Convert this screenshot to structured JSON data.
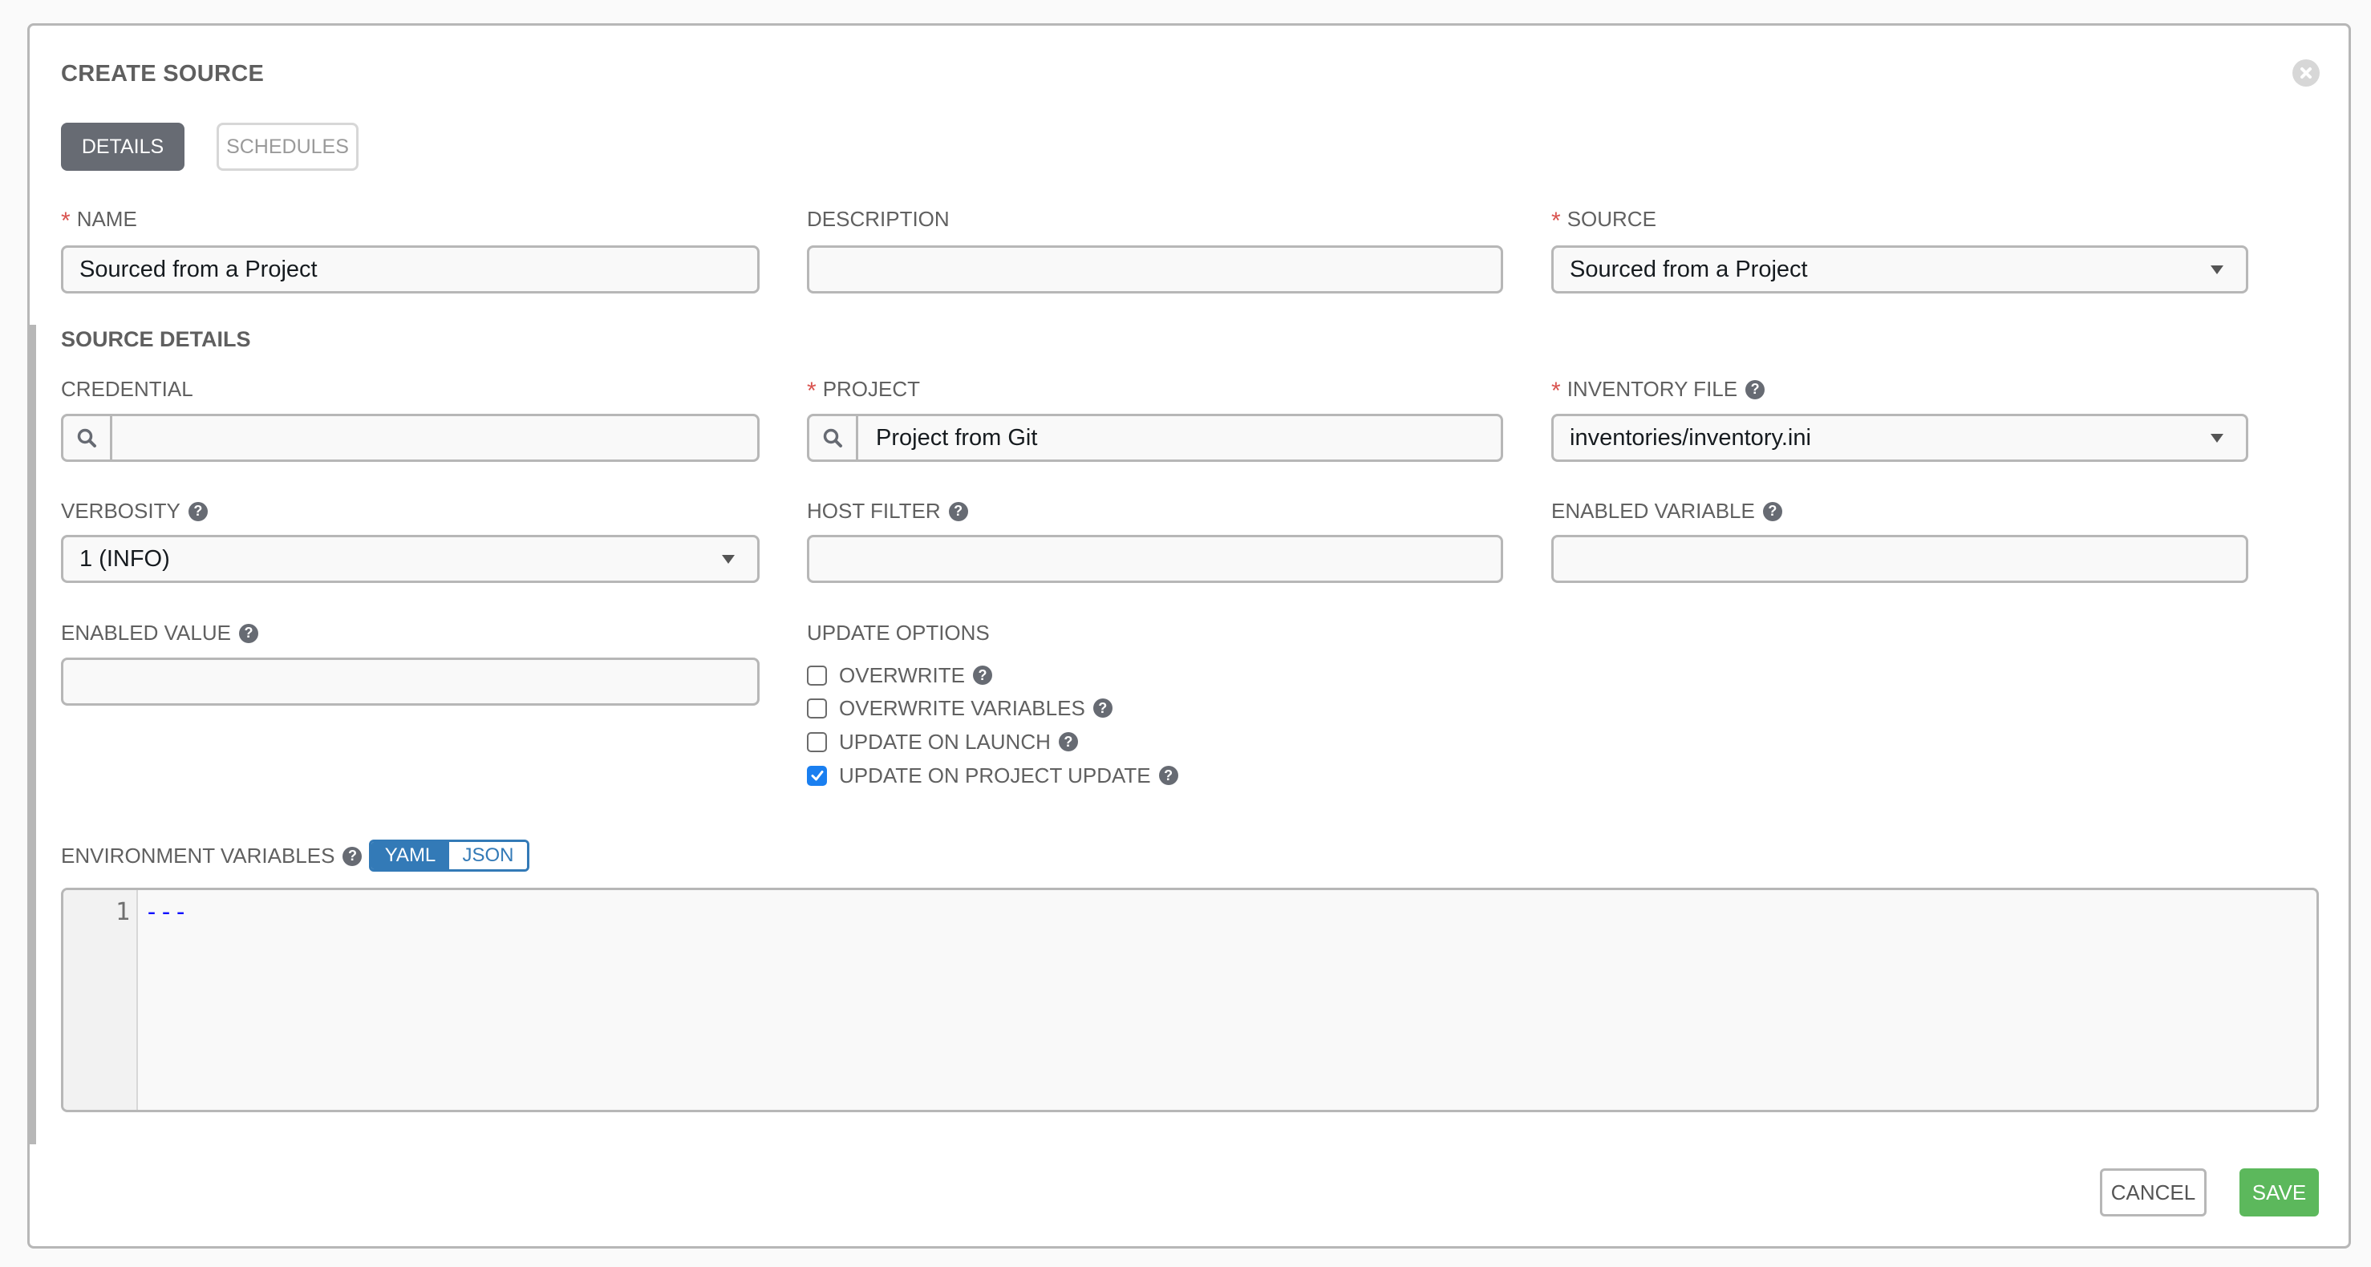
{
  "dialog": {
    "title": "CREATE SOURCE",
    "close_icon": "close-circle-icon"
  },
  "tabs": [
    {
      "label": "DETAILS",
      "active": true
    },
    {
      "label": "SCHEDULES",
      "active": false
    }
  ],
  "fields": {
    "name": {
      "label": "NAME",
      "required": true,
      "value": "Sourced from a Project"
    },
    "description": {
      "label": "DESCRIPTION",
      "required": false,
      "value": ""
    },
    "source": {
      "label": "SOURCE",
      "required": true,
      "value": "Sourced from a Project"
    }
  },
  "source_details": {
    "heading": "SOURCE DETAILS",
    "credential": {
      "label": "CREDENTIAL",
      "value": ""
    },
    "project": {
      "label": "PROJECT",
      "required": true,
      "value": "Project from Git"
    },
    "inventory_file": {
      "label": "INVENTORY FILE",
      "required": true,
      "value": "inventories/inventory.ini"
    },
    "verbosity": {
      "label": "VERBOSITY",
      "value": "1 (INFO)"
    },
    "host_filter": {
      "label": "HOST FILTER",
      "value": ""
    },
    "enabled_variable": {
      "label": "ENABLED VARIABLE",
      "value": ""
    },
    "enabled_value": {
      "label": "ENABLED VALUE",
      "value": ""
    },
    "update_options": {
      "label": "UPDATE OPTIONS",
      "items": [
        {
          "label": "OVERWRITE",
          "checked": false
        },
        {
          "label": "OVERWRITE VARIABLES",
          "checked": false
        },
        {
          "label": "UPDATE ON LAUNCH",
          "checked": false
        },
        {
          "label": "UPDATE ON PROJECT UPDATE",
          "checked": true
        }
      ]
    },
    "environment_variables": {
      "label": "ENVIRONMENT VARIABLES",
      "modes": [
        "YAML",
        "JSON"
      ],
      "active_mode": "YAML",
      "lines": [
        {
          "number": "1",
          "text": "---"
        }
      ]
    }
  },
  "actions": {
    "cancel": "CANCEL",
    "save": "SAVE"
  },
  "colors": {
    "required": "#d9534f",
    "active_tab": "#676b73",
    "toggle_accent": "#337ab7",
    "checkbox_checked": "#1a7ff0",
    "save": "#5cb85c"
  }
}
